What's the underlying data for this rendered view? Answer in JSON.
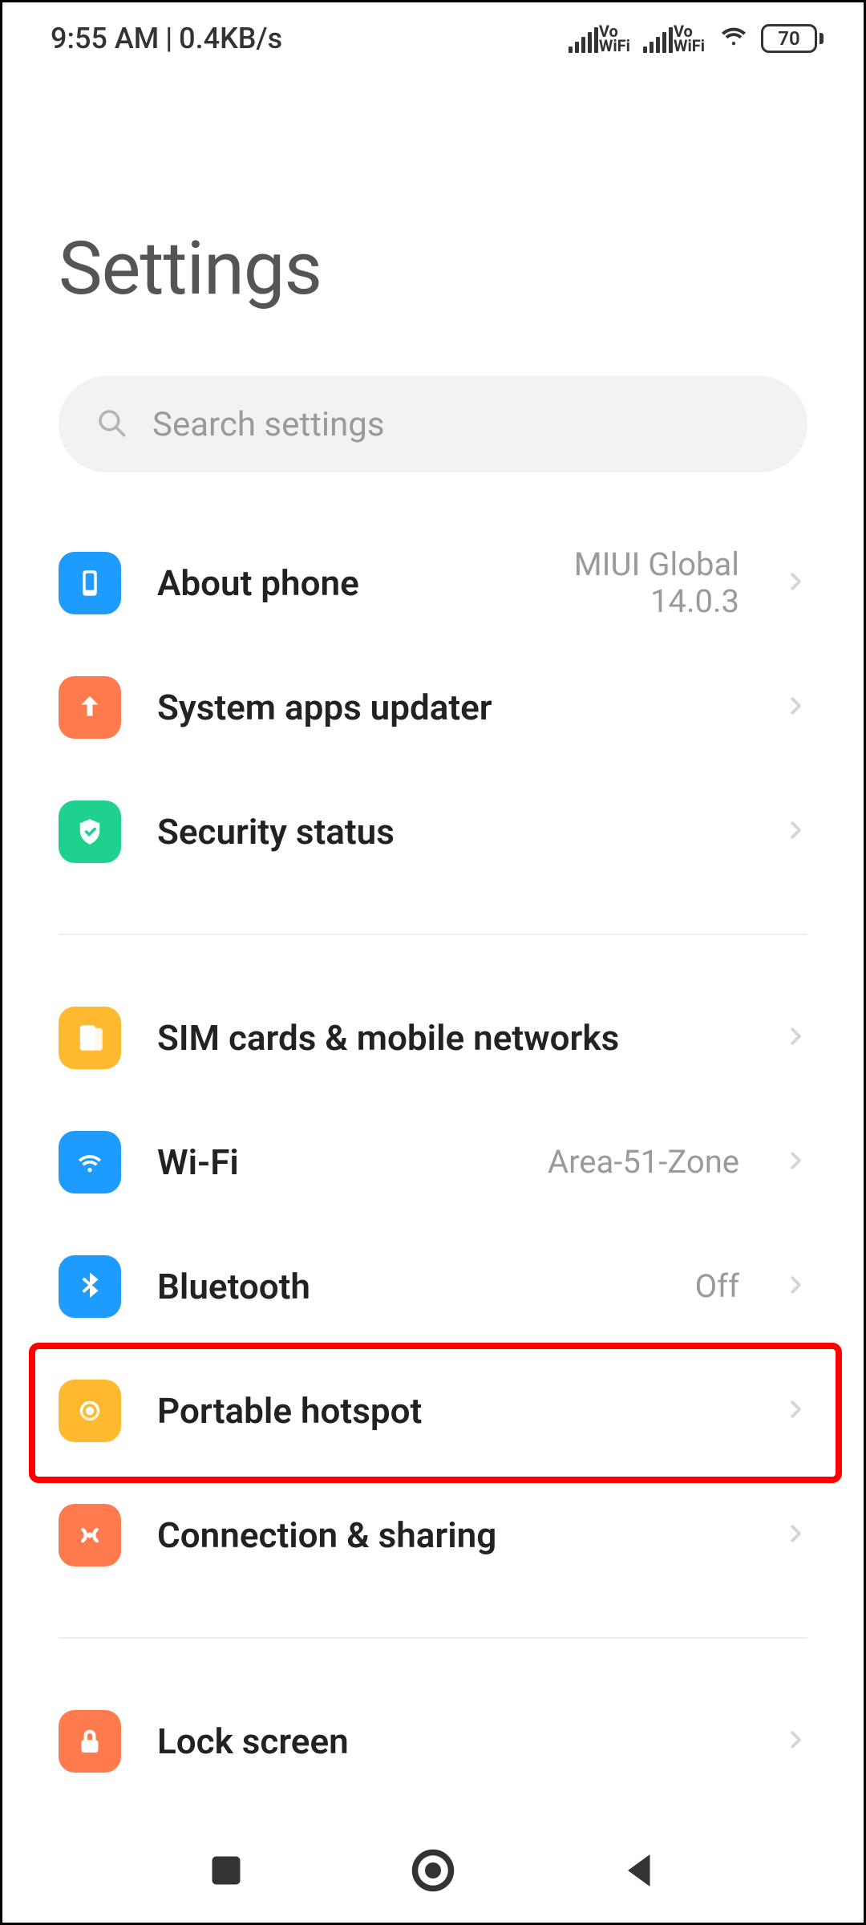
{
  "status": {
    "time": "9:55 AM",
    "sep": "|",
    "speed": "0.4KB/s",
    "vo_wifi": "Vo\nWiFi",
    "battery": "70"
  },
  "header": {
    "title": "Settings"
  },
  "search": {
    "placeholder": "Search settings"
  },
  "groups": [
    {
      "items": [
        {
          "icon": "phone-icon",
          "bg": "bg-blue",
          "label": "About phone",
          "value": "MIUI Global\n14.0.3",
          "twoLine": true
        },
        {
          "icon": "update-icon",
          "bg": "bg-orange",
          "label": "System apps updater",
          "value": ""
        },
        {
          "icon": "shield-icon",
          "bg": "bg-green",
          "label": "Security status",
          "value": ""
        }
      ]
    },
    {
      "items": [
        {
          "icon": "sim-icon",
          "bg": "bg-yellow",
          "label": "SIM cards & mobile networks",
          "value": ""
        },
        {
          "icon": "wifi-icon",
          "bg": "bg-blue",
          "label": "Wi-Fi",
          "value": "Area-51-Zone"
        },
        {
          "icon": "bluetooth-icon",
          "bg": "bg-blue",
          "label": "Bluetooth",
          "value": "Off"
        },
        {
          "icon": "hotspot-icon",
          "bg": "bg-yellow",
          "label": "Portable hotspot",
          "value": "",
          "highlight": true
        },
        {
          "icon": "connection-icon",
          "bg": "bg-orange",
          "label": "Connection & sharing",
          "value": ""
        }
      ]
    },
    {
      "items": [
        {
          "icon": "lock-icon",
          "bg": "bg-orange",
          "label": "Lock screen",
          "value": ""
        }
      ]
    }
  ],
  "navbar": [
    "recents",
    "home",
    "back"
  ]
}
